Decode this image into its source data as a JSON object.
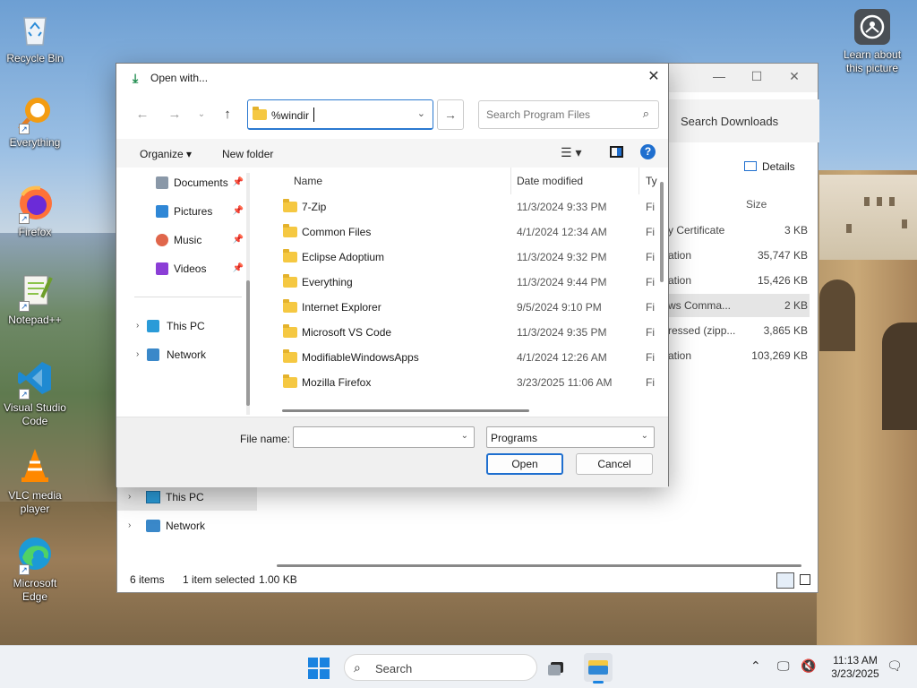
{
  "desktop": {
    "icons": [
      {
        "label": "Recycle Bin"
      },
      {
        "label": "Everything"
      },
      {
        "label": "Firefox"
      },
      {
        "label": "Notepad++"
      },
      {
        "label": "Visual Studio Code"
      },
      {
        "label": "VLC media player"
      },
      {
        "label": "Microsoft Edge"
      }
    ],
    "learn_more": "Learn about this picture"
  },
  "bg_window": {
    "search_placeholder": "Search Downloads",
    "details_label": "Details",
    "size_header": "Size",
    "rows": [
      {
        "type": "y Certificate",
        "size": "3 KB"
      },
      {
        "type": "ation",
        "size": "35,747 KB"
      },
      {
        "type": "ation",
        "size": "15,426 KB"
      },
      {
        "type": "ws Comma...",
        "size": "2 KB"
      },
      {
        "type": "ressed (zipp...",
        "size": "3,865 KB"
      },
      {
        "type": "ation",
        "size": "103,269 KB"
      }
    ],
    "nav": {
      "this_pc": "This PC",
      "network": "Network"
    },
    "status": {
      "items": "6 items",
      "selected": "1 item selected",
      "size": "1.00 KB"
    }
  },
  "dialog": {
    "title": "Open with...",
    "address_value": "%windir",
    "search_placeholder": "Search Program Files",
    "toolbar": {
      "organize": "Organize ▾",
      "new_folder": "New folder"
    },
    "nav": {
      "quick": [
        {
          "label": "Documents"
        },
        {
          "label": "Pictures"
        },
        {
          "label": "Music"
        },
        {
          "label": "Videos"
        }
      ],
      "this_pc": "This PC",
      "network": "Network"
    },
    "columns": {
      "name": "Name",
      "date": "Date modified",
      "type": "Ty"
    },
    "files": [
      {
        "name": "7-Zip",
        "date": "11/3/2024 9:33 PM",
        "type": "Fi"
      },
      {
        "name": "Common Files",
        "date": "4/1/2024 12:34 AM",
        "type": "Fi"
      },
      {
        "name": "Eclipse Adoptium",
        "date": "11/3/2024 9:32 PM",
        "type": "Fi"
      },
      {
        "name": "Everything",
        "date": "11/3/2024 9:44 PM",
        "type": "Fi"
      },
      {
        "name": "Internet Explorer",
        "date": "9/5/2024 9:10 PM",
        "type": "Fi"
      },
      {
        "name": "Microsoft VS Code",
        "date": "11/3/2024 9:35 PM",
        "type": "Fi"
      },
      {
        "name": "ModifiableWindowsApps",
        "date": "4/1/2024 12:26 AM",
        "type": "Fi"
      },
      {
        "name": "Mozilla Firefox",
        "date": "3/23/2025 11:06 AM",
        "type": "Fi"
      }
    ],
    "file_name_label": "File name:",
    "file_name_value": "",
    "file_type": "Programs",
    "open_label": "Open",
    "cancel_label": "Cancel"
  },
  "taskbar": {
    "search_label": "Search",
    "time": "11:13 AM",
    "date": "3/23/2025"
  },
  "colors": {
    "accent": "#1f6fcf",
    "folder": "#f5c842",
    "taskbar": "#eef1f5"
  }
}
